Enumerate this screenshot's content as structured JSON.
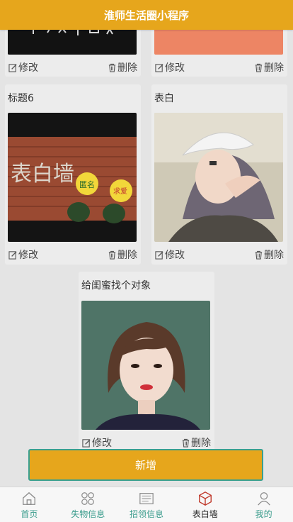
{
  "header": {
    "title": "淮师生活圈小程序"
  },
  "cards": [
    {
      "title": "",
      "edit_label": "修改",
      "delete_label": "删除",
      "image": "dark-banner-photo"
    },
    {
      "title": "",
      "edit_label": "修改",
      "delete_label": "删除",
      "image": "salmon-color-photo"
    },
    {
      "title": "标题6",
      "edit_label": "修改",
      "delete_label": "删除",
      "image": "brick-wall-confession-photo",
      "image_text": {
        "main": "表白墙",
        "badge1": "匿名",
        "badge2": "求爱"
      }
    },
    {
      "title": "表白",
      "edit_label": "修改",
      "delete_label": "删除",
      "image": "girl-with-cap-photo"
    },
    {
      "title": "给闺蜜找个对象",
      "edit_label": "修改",
      "delete_label": "删除",
      "image": "girl-portrait-photo"
    }
  ],
  "add_button": {
    "label": "新增"
  },
  "tabbar": {
    "items": [
      {
        "label": "首页",
        "icon": "home-icon"
      },
      {
        "label": "失物信息",
        "icon": "lost-items-icon"
      },
      {
        "label": "招领信息",
        "icon": "found-items-icon"
      },
      {
        "label": "表白墙",
        "icon": "confession-wall-icon",
        "active": true
      },
      {
        "label": "我的",
        "icon": "profile-icon"
      }
    ]
  },
  "colors": {
    "accent": "#e6a61c",
    "tab_text": "#3a9c8c",
    "button_border": "#3aa090"
  }
}
